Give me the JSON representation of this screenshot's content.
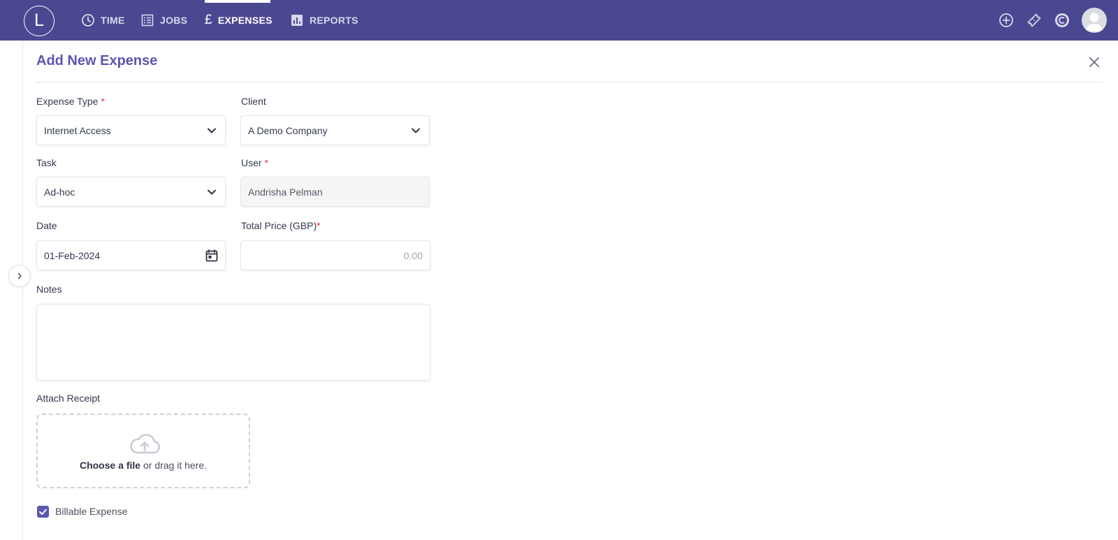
{
  "nav": {
    "logo": "L",
    "items": [
      {
        "label": "TIME",
        "icon": "clock-icon"
      },
      {
        "label": "JOBS",
        "icon": "list-icon"
      },
      {
        "label": "EXPENSES",
        "icon": "pound-icon",
        "glyph": "£",
        "active": true
      },
      {
        "label": "REPORTS",
        "icon": "bar-chart-icon"
      }
    ],
    "right_icons": [
      "add-circle-icon",
      "ticket-icon",
      "c-logo-icon",
      "avatar"
    ]
  },
  "panel": {
    "title": "Add New Expense"
  },
  "form": {
    "expense_type": {
      "label": "Expense Type",
      "required": "*",
      "value": "Internet Access"
    },
    "client": {
      "label": "Client",
      "value": "A Demo Company"
    },
    "task": {
      "label": "Task",
      "value": "Ad-hoc"
    },
    "user": {
      "label": "User",
      "required": "*",
      "value": "Andrisha Pelman"
    },
    "date": {
      "label": "Date",
      "value": "01-Feb-2024"
    },
    "total_price": {
      "label": "Total Price (GBP)",
      "required": "*",
      "placeholder": "0.00"
    },
    "notes": {
      "label": "Notes",
      "value": ""
    },
    "attach": {
      "label": "Attach Receipt",
      "choose": "Choose a file",
      "drag": " or drag it here."
    },
    "billable": {
      "label": "Billable Expense",
      "checked": true
    }
  },
  "colors": {
    "topbar": "#4b4892",
    "accent": "#5a57b0",
    "required": "#e0303a"
  }
}
